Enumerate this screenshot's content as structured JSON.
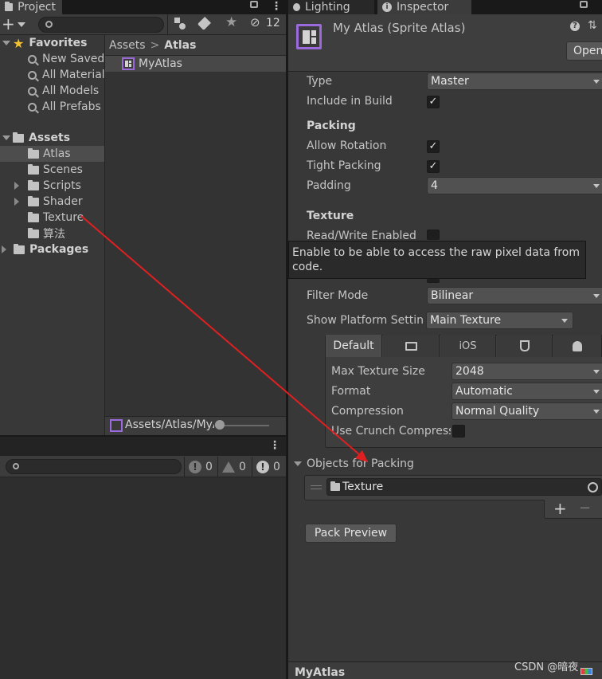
{
  "project_panel": {
    "tab_label": "Project",
    "hidden_count": "12",
    "favorites": {
      "label": "Favorites",
      "items": [
        "New Saved Search",
        "All Materials",
        "All Models",
        "All Prefabs"
      ]
    },
    "assets": {
      "label": "Assets",
      "items": [
        {
          "label": "Atlas",
          "expandable": false,
          "selected": true
        },
        {
          "label": "Scenes",
          "expandable": false,
          "selected": false
        },
        {
          "label": "Scripts",
          "expandable": true,
          "selected": false
        },
        {
          "label": "Shader",
          "expandable": true,
          "selected": false
        },
        {
          "label": "Texture",
          "expandable": false,
          "selected": false
        },
        {
          "label": "算法",
          "expandable": false,
          "selected": false
        }
      ]
    },
    "packages_label": "Packages",
    "breadcrumb": {
      "root": "Assets",
      "separator": ">",
      "current": "Atlas"
    },
    "files": [
      "MyAtlas"
    ],
    "footer_path": "Assets/Atlas/MyAtlas.spriteatlas"
  },
  "console_panel": {
    "errors_count": "0",
    "warnings_count": "0",
    "logs_count": "0"
  },
  "inspector": {
    "tabs": {
      "lighting": "Lighting",
      "inspector": "Inspector"
    },
    "title": "My Atlas (Sprite Atlas)",
    "open_button": "Open",
    "type_label": "Type",
    "type_value": "Master",
    "include_in_build_label": "Include in Build",
    "packing_header": "Packing",
    "allow_rotation_label": "Allow Rotation",
    "tight_packing_label": "Tight Packing",
    "padding_label": "Padding",
    "padding_value": "4",
    "texture_header": "Texture",
    "read_write_label": "Read/Write Enabled",
    "tooltip_text": "Enable to be able to access the raw pixel data from code.",
    "filter_mode_label": "Filter Mode",
    "filter_mode_value": "Bilinear",
    "show_platform_label": "Show Platform Settings For",
    "show_platform_value": "Main Texture",
    "platform_tabs": {
      "default": "Default",
      "ios": "iOS"
    },
    "max_texture_size_label": "Max Texture Size",
    "max_texture_size_value": "2048",
    "format_label": "Format",
    "format_value": "Automatic",
    "compression_label": "Compression",
    "compression_value": "Normal Quality",
    "crunch_label": "Use Crunch Compression",
    "objects_header": "Objects for Packing",
    "objects_item": "Texture",
    "add_symbol": "+",
    "remove_symbol": "−",
    "pack_preview_button": "Pack Preview",
    "preview_title": "MyAtlas"
  },
  "watermark": "CSDN @暗夜",
  "colors": {
    "selection": "#4d4d4d",
    "arrow": "#e02020",
    "accent_icon": "#9b6bdc",
    "star": "#f2c12e"
  }
}
